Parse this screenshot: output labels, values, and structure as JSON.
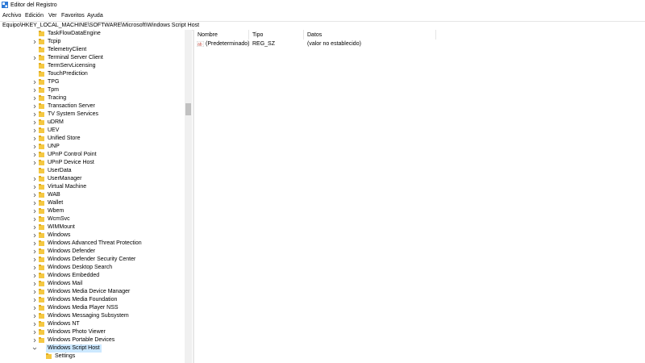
{
  "window": {
    "title": "Editor del Registro",
    "accent": "#2b78d6"
  },
  "menu": [
    "Archivo",
    "Edición",
    "Ver",
    "Favoritos",
    "Ayuda"
  ],
  "address": "Equipo\\HKEY_LOCAL_MACHINE\\SOFTWARE\\Microsoft\\Windows Script Host",
  "tree": {
    "items": [
      {
        "label": "TaskFlowDataEngine",
        "expander": false
      },
      {
        "label": "Tcpip",
        "expander": true
      },
      {
        "label": "TelemetryClient",
        "expander": false
      },
      {
        "label": "Terminal Server Client",
        "expander": true
      },
      {
        "label": "TermServLicensing",
        "expander": false
      },
      {
        "label": "TouchPrediction",
        "expander": false
      },
      {
        "label": "TPG",
        "expander": true
      },
      {
        "label": "Tpm",
        "expander": true
      },
      {
        "label": "Tracing",
        "expander": true
      },
      {
        "label": "Transaction Server",
        "expander": true
      },
      {
        "label": "TV System Services",
        "expander": true
      },
      {
        "label": "uDRM",
        "expander": true
      },
      {
        "label": "UEV",
        "expander": true
      },
      {
        "label": "Unified Store",
        "expander": true
      },
      {
        "label": "UNP",
        "expander": true
      },
      {
        "label": "UPnP Control Point",
        "expander": true
      },
      {
        "label": "UPnP Device Host",
        "expander": true
      },
      {
        "label": "UserData",
        "expander": false
      },
      {
        "label": "UserManager",
        "expander": true
      },
      {
        "label": "Virtual Machine",
        "expander": true
      },
      {
        "label": "WAB",
        "expander": true
      },
      {
        "label": "Wallet",
        "expander": true
      },
      {
        "label": "Wbem",
        "expander": true
      },
      {
        "label": "WcmSvc",
        "expander": true
      },
      {
        "label": "WIMMount",
        "expander": true
      },
      {
        "label": "Windows",
        "expander": true
      },
      {
        "label": "Windows Advanced Threat Protection",
        "expander": true
      },
      {
        "label": "Windows Defender",
        "expander": true
      },
      {
        "label": "Windows Defender Security Center",
        "expander": true
      },
      {
        "label": "Windows Desktop Search",
        "expander": true
      },
      {
        "label": "Windows Embedded",
        "expander": true
      },
      {
        "label": "Windows Mail",
        "expander": true
      },
      {
        "label": "Windows Media Device Manager",
        "expander": true
      },
      {
        "label": "Windows Media Foundation",
        "expander": true
      },
      {
        "label": "Windows Media Player NSS",
        "expander": true
      },
      {
        "label": "Windows Messaging Subsystem",
        "expander": true
      },
      {
        "label": "Windows NT",
        "expander": true
      },
      {
        "label": "Windows Photo Viewer",
        "expander": true
      },
      {
        "label": "Windows Portable Devices",
        "expander": true
      },
      {
        "label": "Windows Script Host",
        "expander": true,
        "expanded": true,
        "selected": true
      },
      {
        "label": "Settings",
        "expander": false,
        "child": true
      }
    ]
  },
  "values": {
    "columns": [
      "Nombre",
      "Tipo",
      "Datos"
    ],
    "rows": [
      {
        "icon": "string-value-icon",
        "name": "(Predeterminado)",
        "type": "REG_SZ",
        "data": "(valor no establecido)"
      }
    ]
  }
}
